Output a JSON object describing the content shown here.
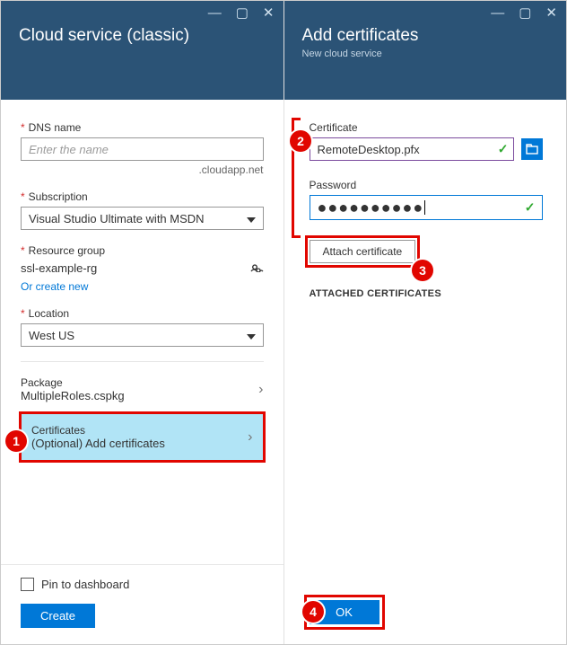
{
  "left": {
    "title": "Cloud service (classic)",
    "dns_label": "DNS name",
    "dns_placeholder": "Enter the name",
    "dns_suffix": ".cloudapp.net",
    "subscription_label": "Subscription",
    "subscription_value": "Visual Studio Ultimate with MSDN",
    "rg_label": "Resource group",
    "rg_value": "ssl-example-rg",
    "rg_create_link": "Or create new",
    "location_label": "Location",
    "location_value": "West US",
    "package_label": "Package",
    "package_value": "MultipleRoles.cspkg",
    "cert_label": "Certificates",
    "cert_value": "(Optional) Add certificates",
    "pin_label": "Pin to dashboard",
    "create_btn": "Create"
  },
  "right": {
    "title": "Add certificates",
    "subtitle": "New cloud service",
    "cert_label": "Certificate",
    "cert_value": "RemoteDesktop.pfx",
    "pwd_label": "Password",
    "pwd_masked": "●●●●●●●●●●",
    "attach_btn": "Attach certificate",
    "attached_header": "ATTACHED CERTIFICATES",
    "ok_btn": "OK"
  },
  "callouts": {
    "c1": "1",
    "c2": "2",
    "c3": "3",
    "c4": "4"
  }
}
